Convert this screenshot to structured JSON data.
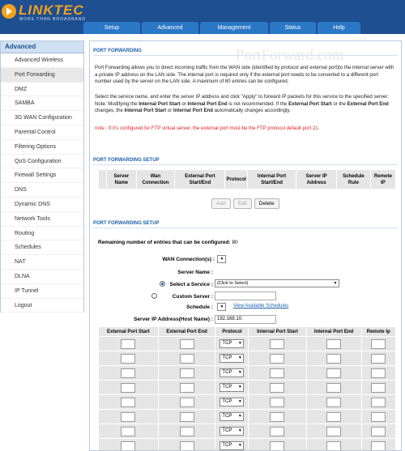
{
  "brand": {
    "name": "LINKTEC",
    "tagline": "MORE THAN BROADBAND"
  },
  "colors": {
    "header_bg": "#1e4f91",
    "tab_bg": "#2a78c6",
    "accent": "#f6a11a",
    "section_head": "#1d5fa8",
    "note": "#d22222"
  },
  "tabs": [
    {
      "label": "Setup"
    },
    {
      "label": "Advanced"
    },
    {
      "label": "Management"
    },
    {
      "label": "Status"
    },
    {
      "label": "Help"
    }
  ],
  "sidebar": {
    "title": "Advanced",
    "items": [
      {
        "label": "Advanced Wireless"
      },
      {
        "label": "Port Forwarding"
      },
      {
        "label": "DMZ"
      },
      {
        "label": "SAMBA"
      },
      {
        "label": "3G WAN Configuration"
      },
      {
        "label": "Parental Control"
      },
      {
        "label": "Filtering Options"
      },
      {
        "label": "QoS Configuration"
      },
      {
        "label": "Firewall Settings"
      },
      {
        "label": "DNS"
      },
      {
        "label": "Dynamic DNS"
      },
      {
        "label": "Network Tools"
      },
      {
        "label": "Routing"
      },
      {
        "label": "Schedules"
      },
      {
        "label": "NAT"
      },
      {
        "label": "DLNA"
      },
      {
        "label": "IP Tunnel"
      },
      {
        "label": "Logout"
      }
    ],
    "active_index": 1
  },
  "main": {
    "watermark": "PortForward.com",
    "title": "PORT FORWARDING",
    "intro": "Port Forwarding allows you to direct incoming traffic from the WAN side (identified by protocol and external port)to the internal server with a private IP address on the LAN side. The internal port is required only if the external port needs to be converted to a different port number used by the server on the LAN side. A maximum of 80 entries can be configured.",
    "desc": {
      "t1": "Select the service name, and enter the server IP address and click \"Apply\" to forward IP packets for this service to the specified server. Note: Modifying the ",
      "b1": "Internal Port Start",
      "t2": " or ",
      "b2": "Internal Port End",
      "t3": " is not recommended. If the ",
      "b3": "External Port Start",
      "t4": " or the ",
      "b4": "External Port End",
      "t5": " changes, the ",
      "b5": "Internal Port Start",
      "t6": " or ",
      "b6": "Internal Port End",
      "t7": " automatically changes accordingly."
    },
    "note": "note : If it's configured for FTP virtual server, the external port must be the FTP protocol default port 21.",
    "setup_title_1": "PORT FORWARDING SETUP",
    "rules_headers": [
      "Server Name",
      "Wan Connection",
      "External Port Start/End",
      "Protocol",
      "Internal Port Start/End",
      "Server IP Address",
      "Schedule Rule",
      "Remote IP"
    ],
    "buttons": {
      "add": "Add",
      "edit": "Edit",
      "delete": "Delete"
    },
    "setup_title_2": "PORT FORWARDING SETUP",
    "remaining_label": "Remaining number of entries that can be configured:",
    "remaining_value": "80",
    "form": {
      "wan_label": "WAN Connection(s) :",
      "server_name_label": "Server Name :",
      "select_service_label": "Select a Service :",
      "select_service_value": "(Click to Select)",
      "custom_server_label": "Custom Server :",
      "schedule_label": "Schedule :",
      "schedule_link": "View Available Schedules",
      "server_ip_label": "Server IP Address(Host Name) :",
      "server_ip_value": "192.168.10."
    },
    "port_headers": [
      "External Port Start",
      "External Port End",
      "Protocol",
      "Internal Port Start",
      "Internal Port End",
      "Remote Ip"
    ],
    "protocol_default": "TCP",
    "port_row_count": 8
  }
}
